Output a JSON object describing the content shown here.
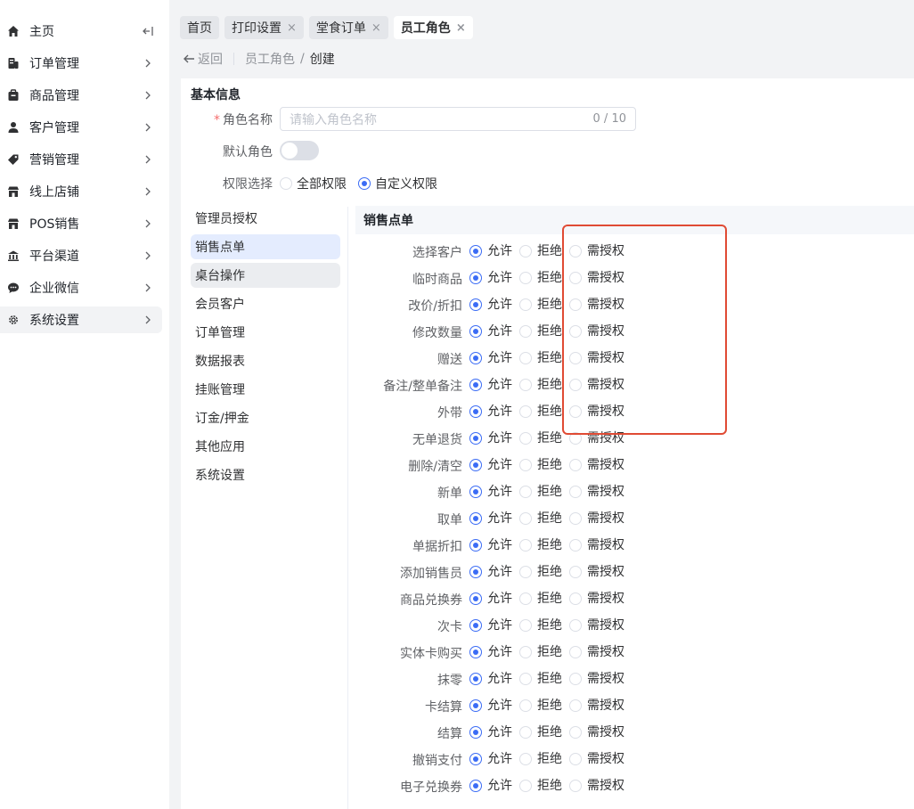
{
  "sidebar": {
    "items": [
      {
        "label": "主页",
        "icon": "home-icon",
        "arrow": "collapse-icon"
      },
      {
        "label": "订单管理",
        "icon": "order-icon",
        "arrow": "chevron-right-icon"
      },
      {
        "label": "商品管理",
        "icon": "goods-icon",
        "arrow": "chevron-right-icon"
      },
      {
        "label": "客户管理",
        "icon": "user-icon",
        "arrow": "chevron-right-icon"
      },
      {
        "label": "营销管理",
        "icon": "tag-icon",
        "arrow": "chevron-right-icon"
      },
      {
        "label": "线上店铺",
        "icon": "shop-icon",
        "arrow": "chevron-right-icon"
      },
      {
        "label": "POS销售",
        "icon": "pos-icon",
        "arrow": "chevron-right-icon"
      },
      {
        "label": "平台渠道",
        "icon": "channel-icon",
        "arrow": "chevron-right-icon"
      },
      {
        "label": "企业微信",
        "icon": "wechat-icon",
        "arrow": "chevron-right-icon"
      },
      {
        "label": "系统设置",
        "icon": "gear-icon",
        "arrow": "chevron-right-icon"
      }
    ]
  },
  "tabs": [
    {
      "label": "首页",
      "closable": false
    },
    {
      "label": "打印设置",
      "closable": true,
      "close": "×"
    },
    {
      "label": "堂食订单",
      "closable": true,
      "close": "×"
    },
    {
      "label": "员工角色",
      "closable": true,
      "close": "×"
    }
  ],
  "breadcrumb": {
    "back": "返回",
    "parent": "员工角色",
    "sep": "/",
    "current": "创建"
  },
  "basic": {
    "title": "基本信息",
    "role_name_label": "角色名称",
    "required_mark": "*",
    "role_name_placeholder": "请输入角色名称",
    "role_name_count": "0 / 10",
    "default_role_label": "默认角色",
    "default_role_on": false,
    "perm_select_label": "权限选择",
    "perm_all": "全部权限",
    "perm_custom": "自定义权限",
    "perm_selected": "custom"
  },
  "categories": [
    {
      "label": "管理员授权"
    },
    {
      "label": "销售点单"
    },
    {
      "label": "桌台操作"
    },
    {
      "label": "会员客户"
    },
    {
      "label": "订单管理"
    },
    {
      "label": "数据报表"
    },
    {
      "label": "挂账管理"
    },
    {
      "label": "订金/押金"
    },
    {
      "label": "其他应用"
    },
    {
      "label": "系统设置"
    }
  ],
  "permissions": {
    "section_title": "销售点单",
    "option_labels": {
      "allow": "允许",
      "deny": "拒绝",
      "auth": "需授权"
    },
    "rows": [
      {
        "name": "选择客户",
        "selected": "allow"
      },
      {
        "name": "临时商品",
        "selected": "allow"
      },
      {
        "name": "改价/折扣",
        "selected": "allow"
      },
      {
        "name": "修改数量",
        "selected": "allow"
      },
      {
        "name": "赠送",
        "selected": "allow"
      },
      {
        "name": "备注/整单备注",
        "selected": "allow"
      },
      {
        "name": "外带",
        "selected": "allow"
      },
      {
        "name": "无单退货",
        "selected": "allow"
      },
      {
        "name": "删除/清空",
        "selected": "allow"
      },
      {
        "name": "新单",
        "selected": "allow"
      },
      {
        "name": "取单",
        "selected": "allow"
      },
      {
        "name": "单据折扣",
        "selected": "allow"
      },
      {
        "name": "添加销售员",
        "selected": "allow"
      },
      {
        "name": "商品兑换券",
        "selected": "allow"
      },
      {
        "name": "次卡",
        "selected": "allow"
      },
      {
        "name": "实体卡购买",
        "selected": "allow"
      },
      {
        "name": "抹零",
        "selected": "allow"
      },
      {
        "name": "卡结算",
        "selected": "allow"
      },
      {
        "name": "结算",
        "selected": "allow"
      },
      {
        "name": "撤销支付",
        "selected": "allow"
      },
      {
        "name": "电子兑换券",
        "selected": "allow"
      }
    ]
  },
  "colors": {
    "accent": "#3b6cf5",
    "highlight_box": "#e04b34",
    "selected_category": "#e4ecfe"
  }
}
